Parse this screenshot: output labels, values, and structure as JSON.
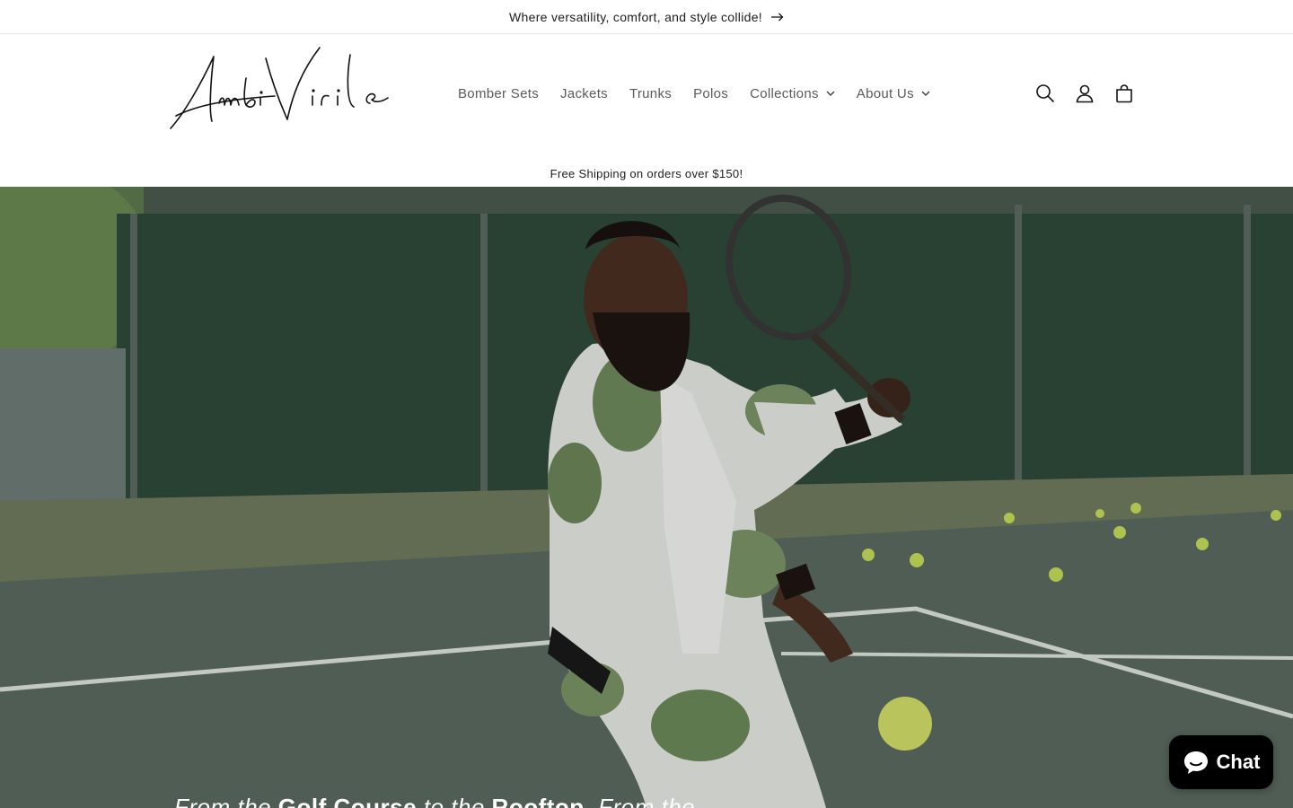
{
  "announcement": {
    "text": "Where versatility, comfort, and style collide!",
    "arrow_icon": "arrow-right-icon"
  },
  "brand": {
    "logo_text": "AmbiVirile"
  },
  "nav": {
    "items": [
      {
        "label": "Bomber Sets",
        "has_dropdown": false
      },
      {
        "label": "Jackets",
        "has_dropdown": false
      },
      {
        "label": "Trunks",
        "has_dropdown": false
      },
      {
        "label": "Polos",
        "has_dropdown": false
      },
      {
        "label": "Collections",
        "has_dropdown": true
      },
      {
        "label": "About Us",
        "has_dropdown": true
      }
    ]
  },
  "header_icons": [
    "search-icon",
    "account-icon",
    "cart-icon"
  ],
  "shipping_banner": {
    "text": "Free Shipping on orders over $150!"
  },
  "hero": {
    "text_part1": "From the ",
    "text_bold1": "Golf Course",
    "text_part2": " to the ",
    "text_bold2": "Rooftop",
    "text_part3": ". From the"
  },
  "chat": {
    "label": "Chat",
    "icon": "chat-bubble-icon",
    "background": "#000000"
  }
}
